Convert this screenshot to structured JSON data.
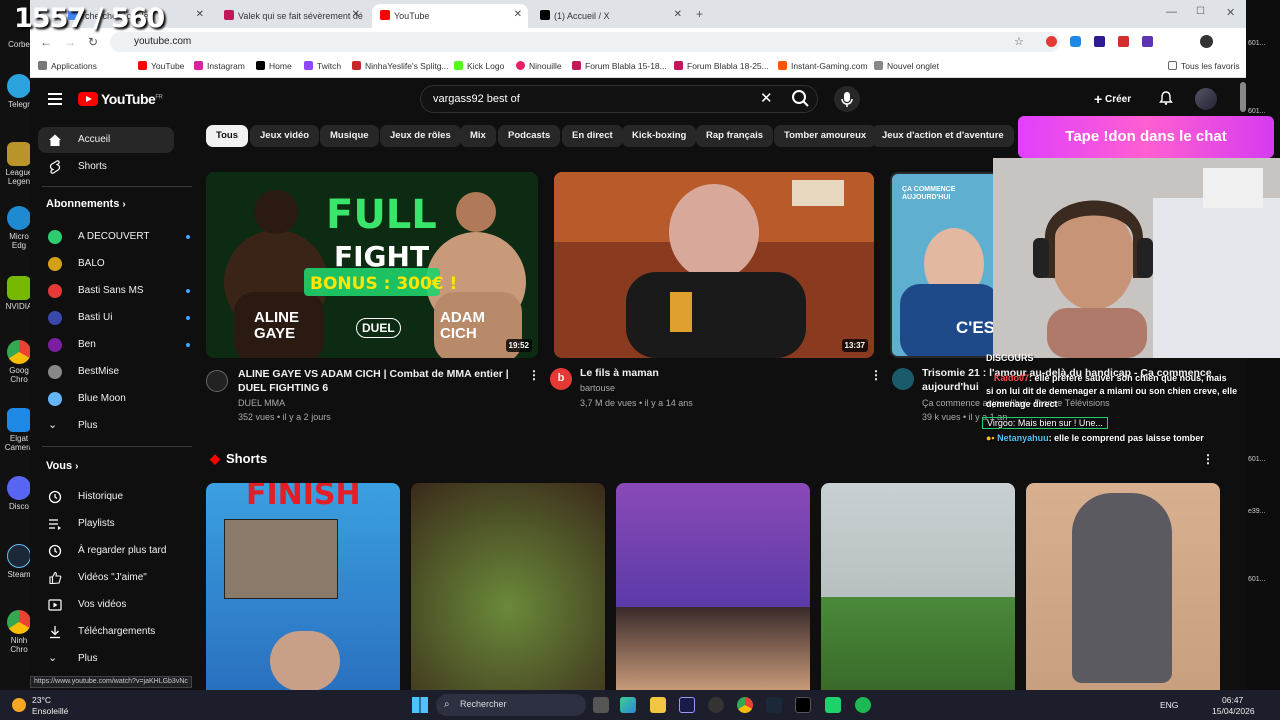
{
  "stream": {
    "counter": "1557 / 560",
    "don_banner": "Tape !don dans le chat",
    "chat_header": "DISCOURS",
    "chat_lines": [
      {
        "name": "Kaido07",
        "text": ": elle préfère sauver son chien que nous, mais"
      },
      {
        "name": "",
        "text": "si on lui dit de demenager a miami ou son chien creve, elle"
      },
      {
        "name": "",
        "text": "demenage direct"
      },
      {
        "name": "Virgoo",
        "text": ": Mais bien sur ! Une..."
      },
      {
        "name": "Netanyahuu",
        "text": ": elle le comprend pas laisse tomber"
      }
    ]
  },
  "desktop": {
    "icons": [
      "Corbe",
      "Telegr",
      "League Legen",
      "Micro Edg",
      "NVIDIA",
      "Goog Chro",
      "Elgat Camera",
      "Disco",
      "Steam",
      "Ninh Chro"
    ],
    "right": [
      "601...",
      "601...",
      "601...",
      "e39...",
      "601..."
    ]
  },
  "browser": {
    "tabs": [
      {
        "label": "rcherche Google",
        "color": "#4285f4"
      },
      {
        "label": "Valek qui se fait sévèrement dé",
        "color": "#c2185b"
      },
      {
        "label": "YouTube",
        "color": "#ff0000",
        "active": true
      },
      {
        "label": "(1) Accueil / X",
        "color": "#000000"
      }
    ],
    "url": "youtube.com",
    "bookmarks": [
      {
        "label": "Applications",
        "color": "#666"
      },
      {
        "label": "YouTube",
        "color": "#ff0000"
      },
      {
        "label": "Instagram",
        "color": "#d6249f"
      },
      {
        "label": "Home",
        "color": "#000"
      },
      {
        "label": "Twitch",
        "color": "#9146ff"
      },
      {
        "label": "NinhaYeslife's Splitg...",
        "color": "#c62828"
      },
      {
        "label": "Kick Logo",
        "color": "#53fc18"
      },
      {
        "label": "Ninouille",
        "color": "#e91e63"
      },
      {
        "label": "Forum Blabla 15-18...",
        "color": "#c2185b"
      },
      {
        "label": "Forum Blabla 18-25...",
        "color": "#c2185b"
      },
      {
        "label": "Instant-Gaming.com",
        "color": "#ff5400"
      },
      {
        "label": "Nouvel onglet",
        "color": "#888"
      }
    ],
    "all_bookmarks": "Tous les favoris",
    "status_url": "https://www.youtube.com/watch?v=jaKHLGb3vNc"
  },
  "youtube": {
    "logo": "YouTube",
    "region": "FR",
    "search_value": "vargass92 best of",
    "create_label": "Créer",
    "sidebar": {
      "home": "Accueil",
      "shorts": "Shorts",
      "subscriptions": "Abonnements",
      "channels": [
        {
          "name": "A DECOUVERT",
          "color": "#2ecc71",
          "dot": true
        },
        {
          "name": "BALO",
          "color": "#d4a017",
          "dot": false
        },
        {
          "name": "Basti Sans MS",
          "color": "#e53935",
          "dot": true
        },
        {
          "name": "Basti Ui",
          "color": "#3949ab",
          "dot": true
        },
        {
          "name": "Ben",
          "color": "#7b1fa2",
          "dot": true
        },
        {
          "name": "BestMise",
          "color": "#888888",
          "dot": false
        },
        {
          "name": "Blue Moon",
          "color": "#64b5f6",
          "dot": false
        }
      ],
      "more": "Plus",
      "you": "Vous",
      "you_items": [
        "Historique",
        "Playlists",
        "À regarder plus tard",
        "Vidéos \"J'aime\"",
        "Vos vidéos",
        "Téléchargements",
        "Plus"
      ]
    },
    "chips": [
      "Tous",
      "Jeux vidéo",
      "Musique",
      "Jeux de rôles",
      "Mix",
      "Podcasts",
      "En direct",
      "Kick-boxing",
      "Rap français",
      "Tomber amoureux",
      "Jeux d'action et d'aventure"
    ],
    "videos": [
      {
        "title_line1": "ALINE GAYE VS ADAM CICH | Combat de MMA entier |",
        "title_line2": "DUEL FIGHTING 6",
        "channel": "DUEL MMA",
        "meta": "352 vues • il y a 2 jours",
        "duration": "19:52",
        "thumb_text": {
          "full": "FULL",
          "fight": "FIGHT",
          "bonus": "BONUS : 300€ !",
          "left": "ALINE GAYE",
          "right": "ADAM CICH",
          "logo": "DUEL"
        }
      },
      {
        "title_line1": "Le fils à maman",
        "title_line2": "",
        "channel": "bartouse",
        "meta": "3,7 M de vues • il y a 14 ans",
        "duration": "13:37",
        "channel_letter": "b"
      },
      {
        "title_line1": "Trisomie 21 : l'amour au-delà du handicap - Ça commence",
        "title_line2": "aujourd'hui",
        "channel": "Ça commence aujourd'hui - France Télévisions",
        "meta": "39 k vues • il y a 1 an",
        "thumb_text": "ÇA COMMENCE AUJOURD'HUI"
      }
    ],
    "shorts_title": "Shorts"
  },
  "taskbar": {
    "weather_temp": "23°C",
    "weather_desc": "Ensoleillé",
    "search": "Rechercher",
    "lang": "ENG",
    "time": "06:47",
    "date": "15/04/2026"
  }
}
